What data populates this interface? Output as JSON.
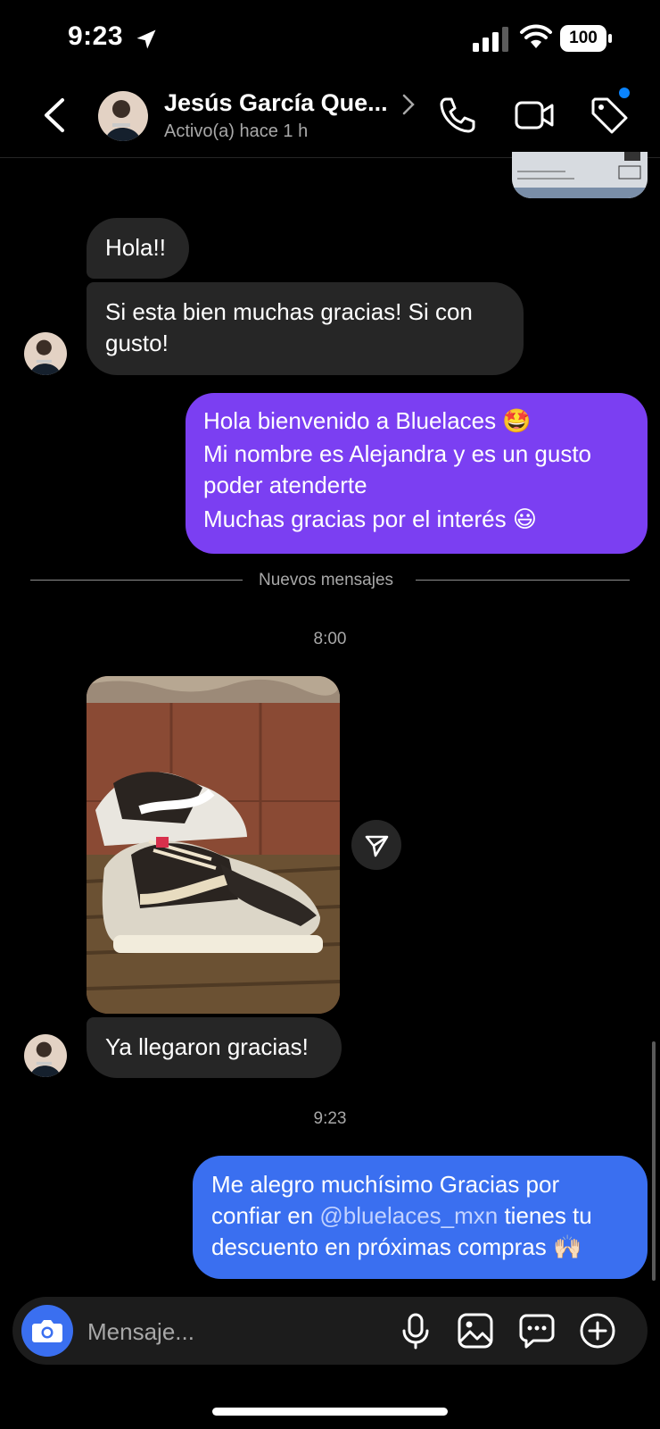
{
  "status_bar": {
    "time": "9:23",
    "battery": "100",
    "icons": [
      "location-arrow-icon",
      "signal-icon",
      "wifi-icon",
      "battery-icon"
    ]
  },
  "header": {
    "contact_name": "Jesús García Que...",
    "contact_status": "Activo(a) hace 1 h",
    "icons": [
      "back-icon",
      "chevron-right-icon",
      "phone-icon",
      "video-icon",
      "tag-icon"
    ],
    "notification_color": "#0a84ff"
  },
  "messages": [
    {
      "direction": "incoming",
      "text": "Hola!!"
    },
    {
      "direction": "incoming",
      "lines": [
        "Si esta bien muchas gracias! Si con",
        "gusto!"
      ]
    },
    {
      "direction": "outgoing",
      "lines": [
        "Hola bienvenido a Bluelaces 🤩",
        "Mi nombre es Alejandra y es un gusto",
        "poder atenderte",
        "Muchas gracias por el interés 😃"
      ]
    },
    {
      "direction": "incoming",
      "type": "photo",
      "description": "sneakers"
    },
    {
      "direction": "incoming",
      "text": "Ya llegaron gracias!"
    },
    {
      "direction": "outgoing",
      "line1": "Me alegro muchísimo Gracias por",
      "line2_pre": "confiar en ",
      "mention": "@bluelaces_mxn",
      "line2_post": " tienes tu",
      "line3": "descuento en próximas compras 🙌🏻"
    }
  ],
  "new_messages_label": "Nuevos mensajes",
  "timestamps": [
    "8:00",
    "9:23"
  ],
  "composer": {
    "placeholder": "Mensaje...",
    "icons": [
      "camera-icon",
      "microphone-icon",
      "gallery-icon",
      "sticker-icon",
      "plus-icon"
    ]
  },
  "colors": {
    "outgoing_purple": "#7b3ff2",
    "outgoing_blue": "#3a6ff0",
    "incoming": "#262626",
    "mention": "#c3d3ff"
  }
}
